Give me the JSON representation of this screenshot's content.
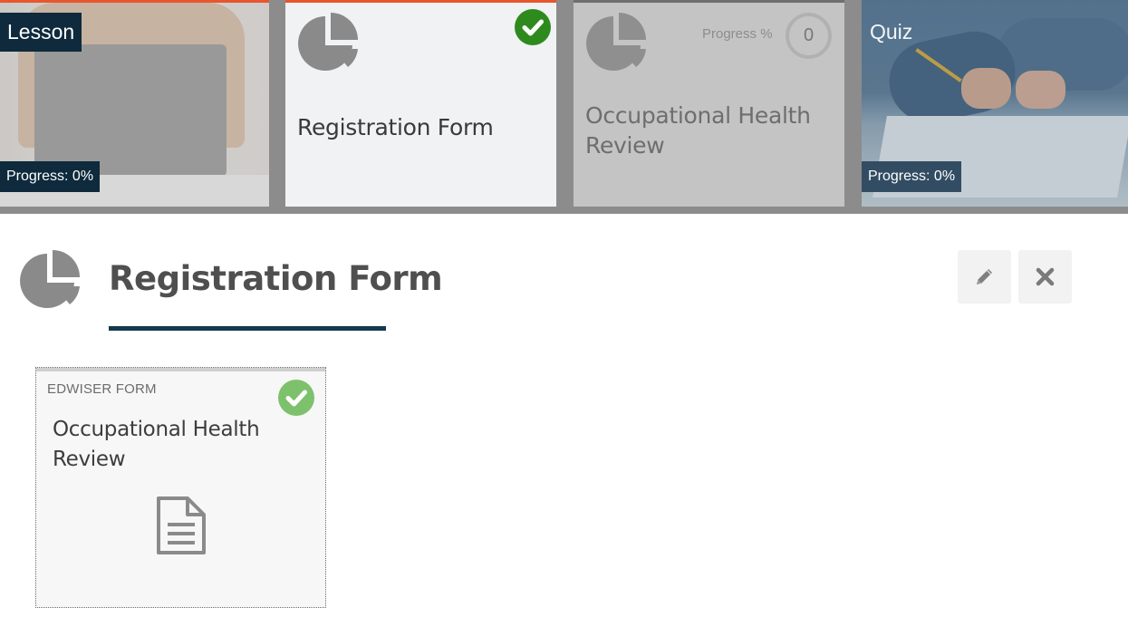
{
  "tiles": [
    {
      "tag": "Lesson",
      "progress": "Progress: 0%"
    },
    {
      "title": "Registration Form",
      "completed": true
    },
    {
      "title": "Occupational Health Review",
      "progress_label": "Progress %",
      "progress_value": "0"
    },
    {
      "tag": "Quiz",
      "progress": "Progress: 0%"
    }
  ],
  "section": {
    "title": "Registration Form"
  },
  "card": {
    "type": "EDWISER FORM",
    "title": "Occupational Health Review",
    "completed": true
  },
  "colors": {
    "accent_orange": "#e8562e",
    "navy": "#0e2a3c",
    "check_green": "#2f8a1e",
    "check_green_light": "#7ec16c",
    "underline": "#14394d"
  },
  "icons": {
    "activity": "pie-chart-icon",
    "edit": "pencil-icon",
    "close": "close-icon",
    "document": "document-icon",
    "complete": "checkmark-icon"
  }
}
